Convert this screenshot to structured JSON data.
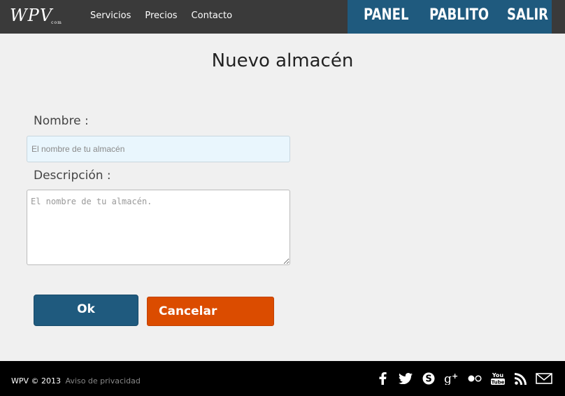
{
  "header": {
    "logo": "WPV",
    "logo_sub": "com",
    "nav": [
      "Servicios",
      "Precios",
      "Contacto"
    ],
    "user_menu": {
      "panel": "PANEL",
      "user": "PABLITO",
      "logout": "SALIR"
    }
  },
  "form": {
    "title": "Nuevo almacén",
    "name_label": "Nombre :",
    "name_placeholder": "El nombre de tu almacén",
    "desc_label": "Descripción :",
    "desc_placeholder": "El nombre de tu almacén.",
    "ok_label": "Ok",
    "cancel_label": "Cancelar"
  },
  "footer": {
    "copyright": "WPV © 2013",
    "privacy": "Aviso de privacidad",
    "social_icons": [
      "facebook-icon",
      "twitter-icon",
      "skype-icon",
      "google-plus-icon",
      "flickr-icon",
      "youtube-icon",
      "rss-icon",
      "mail-icon"
    ]
  },
  "colors": {
    "header_bg": "#3a3a3a",
    "accent_blue": "#1f5a7e",
    "cancel_orange": "#db4c00",
    "footer_bg": "#000000"
  }
}
